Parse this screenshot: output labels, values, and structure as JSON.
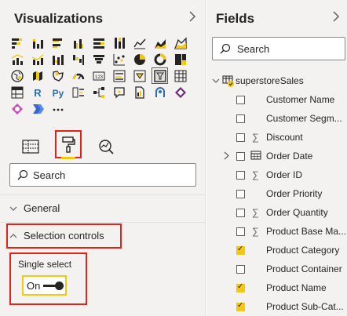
{
  "visualizations": {
    "title": "Visualizations",
    "collapse_icon": "chevron-right-icon",
    "search_placeholder": "Search",
    "tabs": [
      {
        "name": "fields-tab",
        "icon": "table-icon",
        "active": false
      },
      {
        "name": "format-tab",
        "icon": "paint-roller-icon",
        "active": true
      },
      {
        "name": "analytics-tab",
        "icon": "analytics-magnifier-icon",
        "active": false
      }
    ],
    "sections": {
      "general": "General",
      "selection_controls": "Selection controls"
    },
    "single_select": {
      "label": "Single select",
      "toggle_label": "On",
      "value": true
    },
    "icons_rows": [
      [
        "stacked-bar-icon",
        "stacked-column-icon",
        "clustered-bar-icon",
        "clustered-column-icon",
        "100-bar-icon",
        "100-column-icon",
        "line-chart-icon",
        "area-chart-icon",
        "stacked-area-icon"
      ],
      [
        "line-column-icon",
        "line-clustered-icon",
        "ribbon-chart-icon",
        "waterfall-icon",
        "funnel-icon",
        "scatter-icon",
        "pie-icon",
        "donut-icon",
        "treemap-icon"
      ],
      [
        "map-icon",
        "filled-map-icon",
        "shape-map-icon",
        "gauge-icon",
        "card-icon",
        "multirow-card-icon",
        "kpi-icon",
        "slicer-icon",
        "table-visual-icon"
      ],
      [
        "matrix-icon",
        "r-script-icon",
        "python-icon",
        "key-influencers-icon",
        "decomposition-tree-icon",
        "qa-icon",
        "paginated-report-icon",
        "arcgis-icon",
        "power-apps-icon"
      ],
      [
        "power-automate-icon",
        "smart-narrative-icon",
        "more-visuals-icon"
      ]
    ],
    "r_label": "R",
    "py_label": "Py",
    "card_label": "123",
    "more_label": "···"
  },
  "fields": {
    "title": "Fields",
    "collapse_icon": "chevron-right-icon",
    "search_placeholder": "Search",
    "table_name": "superstoreSales",
    "items": [
      {
        "label": "Customer Name",
        "sigma": false,
        "checked": false,
        "expandable": false
      },
      {
        "label": "Customer Segm...",
        "sigma": false,
        "checked": false,
        "expandable": false
      },
      {
        "label": "Discount",
        "sigma": true,
        "checked": false,
        "expandable": false
      },
      {
        "label": "Order Date",
        "sigma": false,
        "checked": false,
        "expandable": true
      },
      {
        "label": "Order ID",
        "sigma": true,
        "checked": false,
        "expandable": false
      },
      {
        "label": "Order Priority",
        "sigma": false,
        "checked": false,
        "expandable": false
      },
      {
        "label": "Order Quantity",
        "sigma": true,
        "checked": false,
        "expandable": false
      },
      {
        "label": "Product Base Ma...",
        "sigma": true,
        "checked": false,
        "expandable": false
      },
      {
        "label": "Product Category",
        "sigma": false,
        "checked": true,
        "expandable": false
      },
      {
        "label": "Product Container",
        "sigma": false,
        "checked": false,
        "expandable": false
      },
      {
        "label": "Product Name",
        "sigma": false,
        "checked": true,
        "expandable": false
      },
      {
        "label": "Product Sub-Cat...",
        "sigma": false,
        "checked": true,
        "expandable": false
      }
    ],
    "sigma_glyph": "∑"
  },
  "colors": {
    "accent": "#f2c811",
    "highlight": "#e2231a",
    "pane_bg": "#f3f2f1"
  }
}
